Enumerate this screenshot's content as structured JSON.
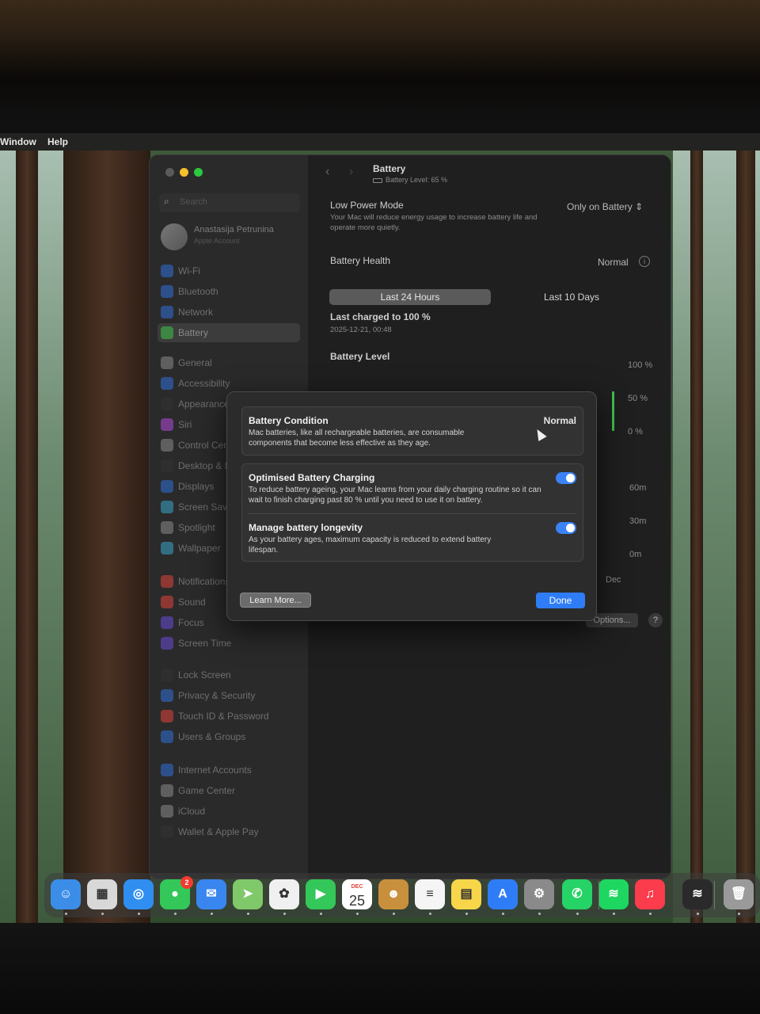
{
  "menubar": {
    "items": [
      "Window",
      "Help"
    ]
  },
  "sidebar": {
    "search_placeholder": "Search",
    "account_name": "Anastasija Petrunina",
    "account_sub": "Apple Account",
    "items": [
      {
        "label": "Wi-Fi",
        "color": "#2f6fd8"
      },
      {
        "label": "Bluetooth",
        "color": "#2f6fd8"
      },
      {
        "label": "Network",
        "color": "#2f6fd8"
      },
      {
        "label": "Battery",
        "color": "#3ec24b",
        "selected": true
      },
      {
        "label": "General",
        "color": "#8a8a8a"
      },
      {
        "label": "Accessibility",
        "color": "#2f6fd8"
      },
      {
        "label": "Appearance",
        "color": "#333333"
      },
      {
        "label": "Siri",
        "color": "#b04ad8"
      },
      {
        "label": "Control Centre",
        "color": "#8a8a8a"
      },
      {
        "label": "Desktop & Dock",
        "color": "#333333"
      },
      {
        "label": "Displays",
        "color": "#2f6fd8"
      },
      {
        "label": "Screen Saver",
        "color": "#38a6c8"
      },
      {
        "label": "Spotlight",
        "color": "#8a8a8a"
      },
      {
        "label": "Wallpaper",
        "color": "#38a6c8"
      },
      {
        "label": "Notifications",
        "color": "#e0413a"
      },
      {
        "label": "Sound",
        "color": "#e0413a"
      },
      {
        "label": "Focus",
        "color": "#6a4ad8"
      },
      {
        "label": "Screen Time",
        "color": "#6a4ad8"
      },
      {
        "label": "Lock Screen",
        "color": "#333333"
      },
      {
        "label": "Privacy & Security",
        "color": "#2f6fd8"
      },
      {
        "label": "Touch ID & Password",
        "color": "#e0413a"
      },
      {
        "label": "Users & Groups",
        "color": "#2f6fd8"
      },
      {
        "label": "Internet Accounts",
        "color": "#2f6fd8"
      },
      {
        "label": "Game Center",
        "color": "#8a8a8a"
      },
      {
        "label": "iCloud",
        "color": "#8a8a8a"
      },
      {
        "label": "Wallet & Apple Pay",
        "color": "#333333"
      }
    ]
  },
  "header": {
    "title": "Battery",
    "subtitle": "Battery Level: 65 %"
  },
  "main": {
    "low_power_label": "Low Power Mode",
    "low_power_desc": "Your Mac will reduce energy usage to increase battery life and operate more quietly.",
    "low_power_value": "Only on Battery",
    "health_label": "Battery Health",
    "health_value": "Normal",
    "tabs": [
      "Last 24 Hours",
      "Last 10 Days"
    ],
    "last_charged_label": "Last charged to 100 %",
    "last_charged_date": "2025-12-21, 00:48",
    "battery_level_label": "Battery Level",
    "axis_level": [
      "100 %",
      "50 %",
      "0 %"
    ],
    "axis_usage": [
      "60m",
      "30m",
      "0m"
    ],
    "axis_date": "Dec",
    "options_label": "Options...",
    "help_label": "?"
  },
  "dialog": {
    "condition_title": "Battery Condition",
    "condition_value": "Normal",
    "condition_desc": "Mac batteries, like all rechargeable batteries, are consumable components that become less effective as they age.",
    "optimised_title": "Optimised Battery Charging",
    "optimised_desc": "To reduce battery ageing, your Mac learns from your daily charging routine so it can wait to finish charging past 80 % until you need to use it on battery.",
    "optimised_on": true,
    "longevity_title": "Manage battery longevity",
    "longevity_desc": "As your battery ages, maximum capacity is reduced to extend battery lifespan.",
    "longevity_on": true,
    "learn_more": "Learn More...",
    "done": "Done"
  },
  "dock": {
    "apps": [
      {
        "name": "Finder",
        "color": "#3b8de8",
        "glyph": "☺"
      },
      {
        "name": "Launchpad",
        "color": "#d8d8d8",
        "glyph": "▦"
      },
      {
        "name": "Safari",
        "color": "#2f8ef0",
        "glyph": "◎"
      },
      {
        "name": "Messages",
        "color": "#34c759",
        "glyph": "●",
        "badge": "2"
      },
      {
        "name": "Mail",
        "color": "#3a86f0",
        "glyph": "✉"
      },
      {
        "name": "Maps",
        "color": "#7fc96a",
        "glyph": "➤"
      },
      {
        "name": "Photos",
        "color": "#f0f0f0",
        "glyph": "✿"
      },
      {
        "name": "FaceTime",
        "color": "#34c759",
        "glyph": "▶"
      },
      {
        "name": "Calendar",
        "color": "#ffffff",
        "glyph": "25",
        "month": "DEC"
      },
      {
        "name": "Contacts",
        "color": "#c8903c",
        "glyph": "☻"
      },
      {
        "name": "Reminders",
        "color": "#f5f5f5",
        "glyph": "≡"
      },
      {
        "name": "Notes",
        "color": "#f7d64a",
        "glyph": "▤"
      },
      {
        "name": "App Store",
        "color": "#2f7df6",
        "glyph": "A"
      },
      {
        "name": "System Settings",
        "color": "#8a8a8a",
        "glyph": "⚙"
      },
      {
        "name": "WhatsApp",
        "color": "#25d366",
        "glyph": "✆"
      },
      {
        "name": "Spotify",
        "color": "#1ed760",
        "glyph": "≋"
      },
      {
        "name": "Music",
        "color": "#fa3c4c",
        "glyph": "♫"
      },
      {
        "name": "Spotify Folder",
        "color": "#2a2a2a",
        "glyph": "≋"
      },
      {
        "name": "Trash",
        "color": "#9a9a9a",
        "glyph": "🗑"
      }
    ]
  }
}
